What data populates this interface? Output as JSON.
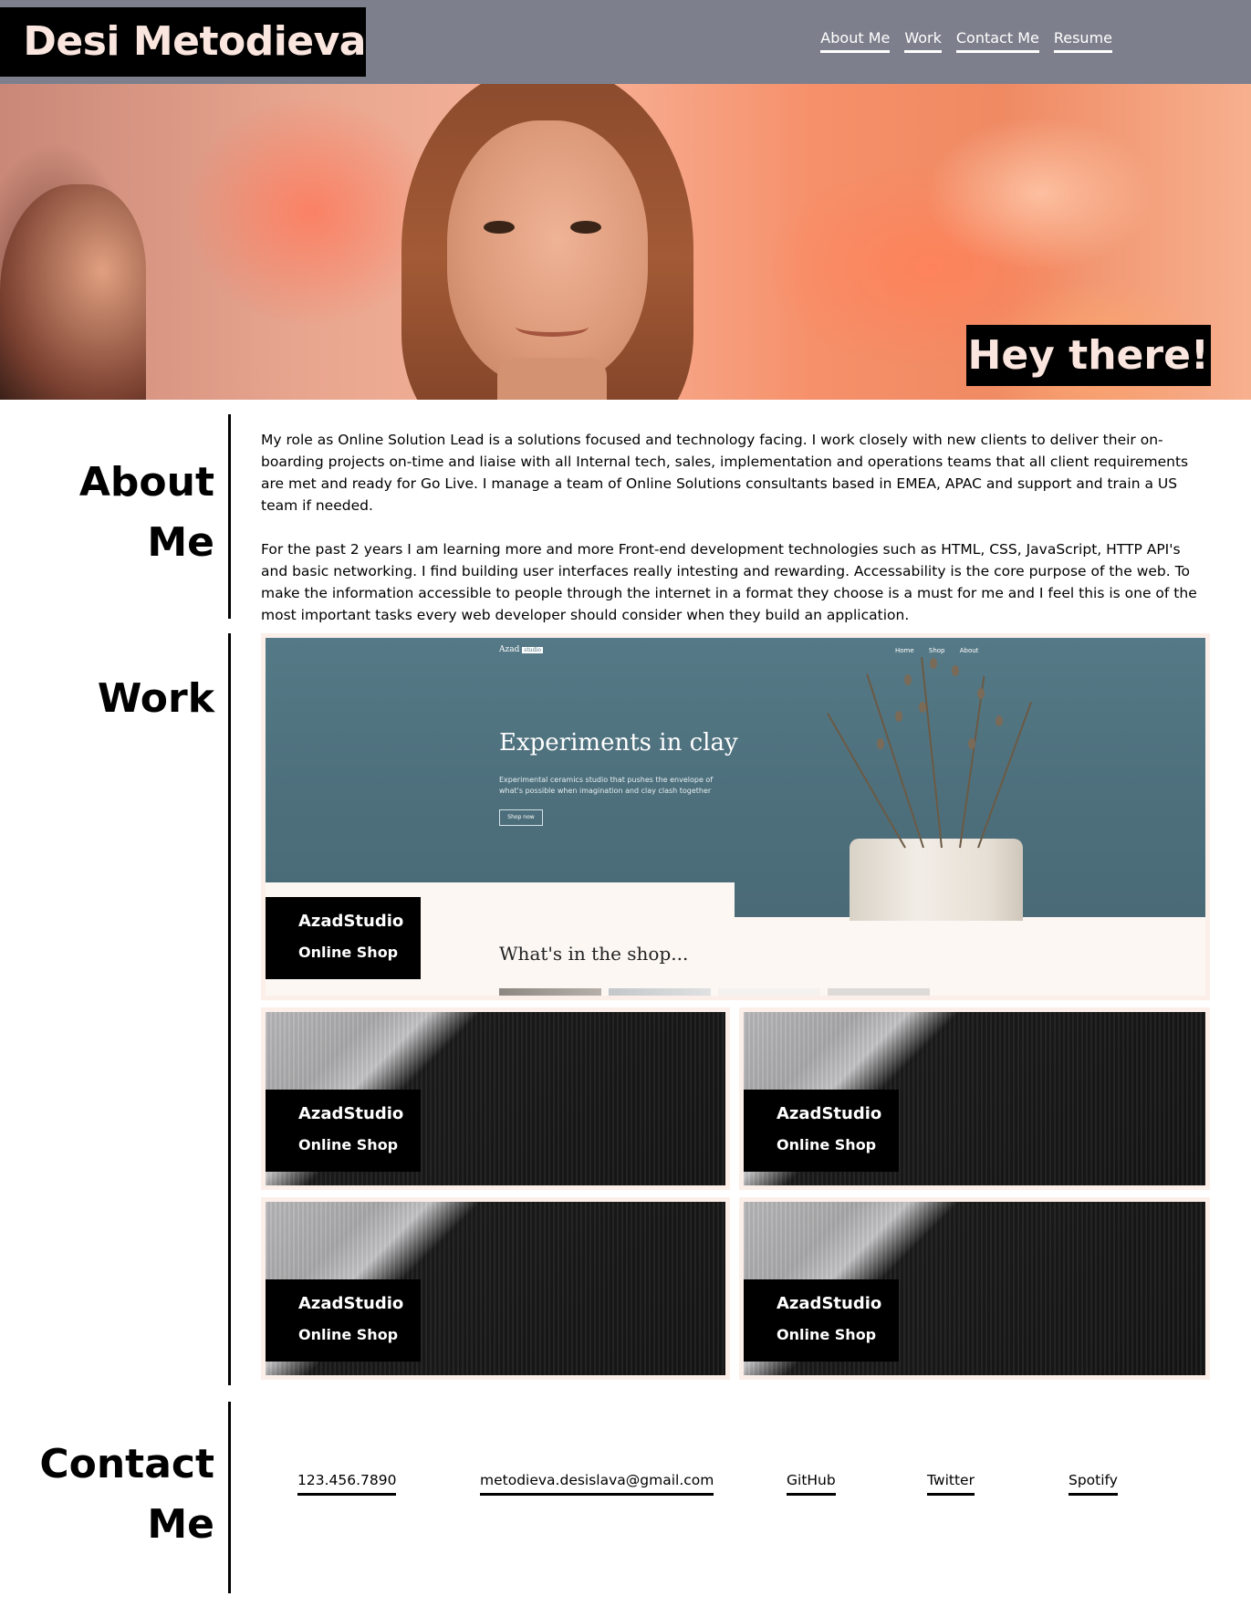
{
  "header": {
    "brand": "Desi Metodieva",
    "nav": [
      "About Me",
      "Work",
      "Contact Me",
      "Resume"
    ]
  },
  "hero": {
    "greeting": "Hey there!"
  },
  "about": {
    "title_line1": "About",
    "title_line2": "Me",
    "paragraph1": "My role as Online Solution Lead is a solutions focused and technology facing. I work closely with new clients to deliver their on-boarding projects on-time and liaise with all Internal tech, sales, implementation and operations teams that all client requirements are met and ready for Go Live. I manage a team of Online Solutions consultants based in EMEA, APAC and support and train a US team if needed.",
    "paragraph2": "For the past 2 years I am learning more and more Front-end development technologies such as HTML, CSS, JavaScript, HTTP API's and basic networking. I find building user interfaces really intesting and rewarding. Accessability is the core purpose of the web. To make the information accessible to people through the internet in a format they choose is a must for me and I feel this is one of the most important tasks every web developer should consider when they build an application."
  },
  "work": {
    "title": "Work",
    "featured_preview": {
      "logo": "Azad",
      "logo_badge": "studio",
      "nav": "Home Shop About",
      "headline": "Experiments in clay",
      "tagline": "Experimental ceramics studio that pushes the envelope of what's possible when imagination and clay clash together",
      "button": "Shop now",
      "section": "What's in the shop..."
    },
    "projects": [
      {
        "name": "AzadStudio",
        "type": "Online Shop"
      },
      {
        "name": "AzadStudio",
        "type": "Online Shop"
      },
      {
        "name": "AzadStudio",
        "type": "Online Shop"
      },
      {
        "name": "AzadStudio",
        "type": "Online Shop"
      },
      {
        "name": "AzadStudio",
        "type": "Online Shop"
      }
    ]
  },
  "contact": {
    "title_line1": "Contact",
    "title_line2": "Me",
    "links": [
      "123.456.7890",
      "metodieva.desislava@gmail.com",
      "GitHub",
      "Twitter",
      "Spotify"
    ]
  },
  "colors": {
    "header_bg": "#7d808c",
    "brand_text": "#fbe6df",
    "card_border": "#fcefe9",
    "label_bg": "#000000"
  }
}
